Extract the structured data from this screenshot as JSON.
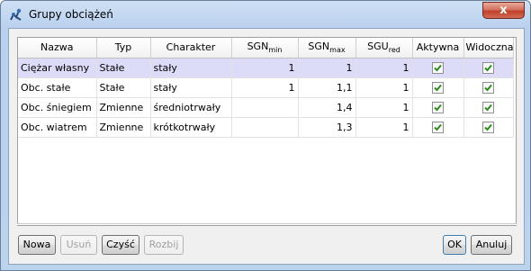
{
  "window": {
    "title": "Grupy obciążeń",
    "close_label": "x"
  },
  "table": {
    "columns": [
      "Nazwa",
      "Typ",
      "Charakter",
      "SGN",
      "SGN",
      "SGU",
      "Aktywna",
      "Widoczna"
    ],
    "column_subs": [
      "",
      "",
      "",
      "min",
      "max",
      "red",
      "",
      ""
    ],
    "rows": [
      {
        "nazwa": "Ciężar własny",
        "typ": "Stałe",
        "charakter": "stały",
        "sgn_min": "1",
        "sgn_max": "1",
        "sgu_red": "1",
        "aktywna": true,
        "widoczna": true,
        "selected": true
      },
      {
        "nazwa": "Obc. stałe",
        "typ": "Stałe",
        "charakter": "stały",
        "sgn_min": "1",
        "sgn_max": "1,1",
        "sgu_red": "1",
        "aktywna": true,
        "widoczna": true,
        "selected": false
      },
      {
        "nazwa": "Obc. śniegiem",
        "typ": "Zmienne",
        "charakter": "średniotrwały",
        "sgn_min": "",
        "sgn_max": "1,4",
        "sgu_red": "1",
        "aktywna": true,
        "widoczna": true,
        "selected": false
      },
      {
        "nazwa": "Obc. wiatrem",
        "typ": "Zmienne",
        "charakter": "krótkotrwały",
        "sgn_min": "",
        "sgn_max": "1,3",
        "sgu_red": "1",
        "aktywna": true,
        "widoczna": true,
        "selected": false
      }
    ]
  },
  "buttons": {
    "new_label": "Nowa",
    "delete_label": "Usuń",
    "clear_label": "Czyść",
    "split_label": "Rozbij",
    "ok_label": "OK",
    "cancel_label": "Anuluj"
  },
  "colors": {
    "selected_row": "#dcdcf8",
    "check_mark": "#2e8b1e",
    "close_button": "#c0402a"
  }
}
